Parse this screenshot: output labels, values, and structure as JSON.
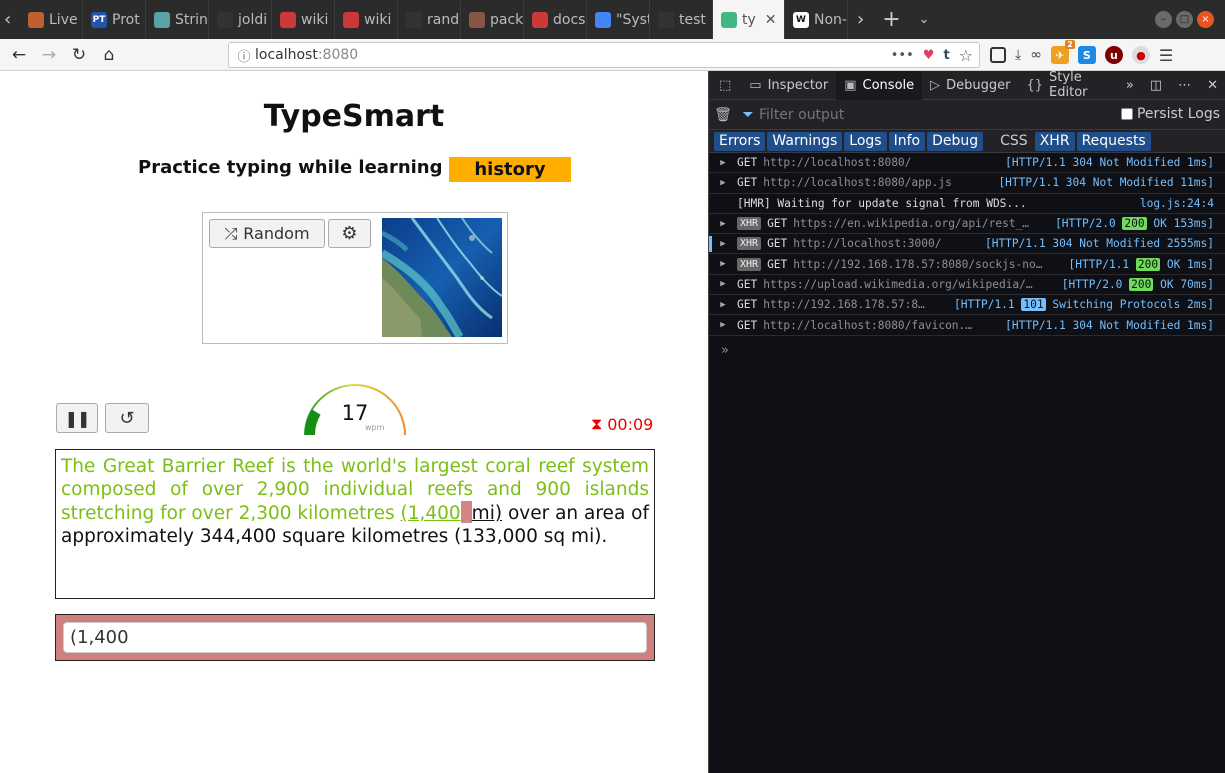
{
  "browser": {
    "tabs": [
      {
        "label": "Live",
        "color": "#c06030"
      },
      {
        "label": "Prot",
        "color": "#2255aa",
        "glyph": "PT"
      },
      {
        "label": "Strin",
        "color": "#5ba3a3"
      },
      {
        "label": "joldi",
        "color": "#333"
      },
      {
        "label": "wiki",
        "color": "#cb3837"
      },
      {
        "label": "wiki",
        "color": "#cb3837"
      },
      {
        "label": "rand",
        "color": "#333"
      },
      {
        "label": "pack",
        "color": "#885544"
      },
      {
        "label": "docs",
        "color": "#cb3837"
      },
      {
        "label": "\"Syst",
        "color": "#4285f4"
      },
      {
        "label": "test",
        "color": "#333"
      },
      {
        "label": "ty",
        "color": "#41b883",
        "active": true
      },
      {
        "label": "Non-",
        "color": "#fff",
        "glyph": "W"
      }
    ],
    "url_host": "localhost",
    "url_port": ":8080",
    "badge_count": "2"
  },
  "app": {
    "title": "TypeSmart",
    "subtitle": "Practice typing while learning",
    "topic": "history",
    "random_label": "Random",
    "wpm": "17",
    "wpm_unit": "wpm",
    "timer": "00:09",
    "gauge_level": 0.17,
    "text_typed": "The Great Barrier Reef is the world's largest coral reef system composed of over 2,900 individual reefs and 900 islands stretching for over 2,300 kilometres ",
    "text_current_typed": "(1,400",
    "text_caret": " ",
    "text_current_rest": "mi)",
    "text_remaining": " over an area of approximately 344,400 square kilometres (133,000 sq mi).",
    "input_value": "(1,400 "
  },
  "devtools": {
    "tabs": [
      "Inspector",
      "Console",
      "Debugger",
      "Style Editor"
    ],
    "selected_tab": "Console",
    "filter_placeholder": "Filter output",
    "persist_label": "Persist Logs",
    "categories": [
      "Errors",
      "Warnings",
      "Logs",
      "Info",
      "Debug",
      "CSS",
      "XHR",
      "Requests"
    ],
    "log": [
      {
        "xhr": false,
        "method": "GET",
        "url": "http://localhost:8080/",
        "proto": "[HTTP/1.1 ",
        "code": "304",
        "rest": " Not Modified 1ms]",
        "badge": ""
      },
      {
        "xhr": false,
        "method": "GET",
        "url": "http://localhost:8080/app.js",
        "proto": "[HTTP/1.1 ",
        "code": "304",
        "rest": " Not Modified 11ms]",
        "badge": ""
      },
      {
        "hmr": "[HMR] Waiting for update signal from WDS...",
        "src": "log.js:24:4"
      },
      {
        "xhr": true,
        "method": "GET",
        "url": "https://en.wikipedia.org/api/rest_…",
        "proto": "[HTTP/2.0 ",
        "code": "200",
        "rest": " OK 153ms]",
        "badge": "b200"
      },
      {
        "xhr": true,
        "method": "GET",
        "url": "http://localhost:3000/",
        "proto": "[HTTP/1.1 ",
        "code": "304",
        "rest": " Not Modified 2555ms]",
        "badge": ""
      },
      {
        "xhr": true,
        "method": "GET",
        "url": "http://192.168.178.57:8080/sockjs-no…",
        "proto": "[HTTP/1.1 ",
        "code": "200",
        "rest": " OK 1ms]",
        "badge": "b200"
      },
      {
        "xhr": false,
        "method": "GET",
        "url": "https://upload.wikimedia.org/wikipedia/…",
        "proto": "[HTTP/2.0 ",
        "code": "200",
        "rest": " OK 70ms]",
        "badge": "b200"
      },
      {
        "xhr": false,
        "method": "GET",
        "url": "http://192.168.178.57:8…",
        "proto": "[HTTP/1.1 ",
        "code": "101",
        "rest": " Switching Protocols 2ms]",
        "badge": "b101"
      },
      {
        "xhr": false,
        "method": "GET",
        "url": "http://localhost:8080/favicon.…",
        "proto": "[HTTP/1.1 ",
        "code": "304",
        "rest": " Not Modified 1ms]",
        "badge": ""
      }
    ],
    "prompt": "»"
  }
}
